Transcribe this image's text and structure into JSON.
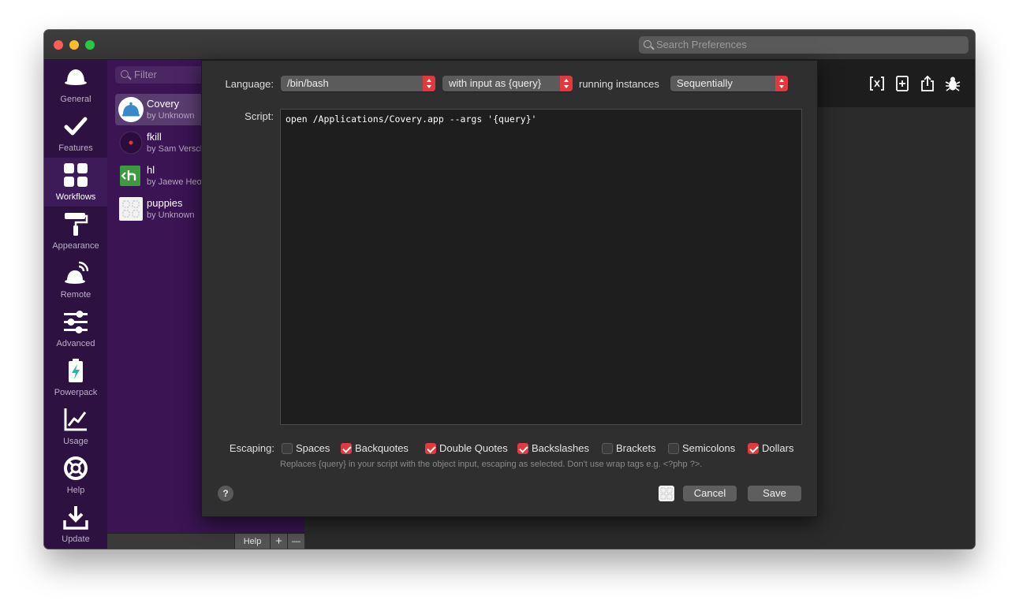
{
  "search": {
    "placeholder": "Search Preferences"
  },
  "sidebar": {
    "items": [
      {
        "label": "General",
        "icon": "hat-icon"
      },
      {
        "label": "Features",
        "icon": "checkmark-icon"
      },
      {
        "label": "Workflows",
        "icon": "grid-icon"
      },
      {
        "label": "Appearance",
        "icon": "paint-roller-icon"
      },
      {
        "label": "Remote",
        "icon": "remote-icon"
      },
      {
        "label": "Advanced",
        "icon": "sliders-icon"
      },
      {
        "label": "Powerpack",
        "icon": "battery-bolt-icon"
      },
      {
        "label": "Usage",
        "icon": "chart-icon"
      },
      {
        "label": "Help",
        "icon": "lifebuoy-icon"
      },
      {
        "label": "Update",
        "icon": "download-icon"
      }
    ],
    "active": "Workflows"
  },
  "workflows": {
    "filter_placeholder": "Filter",
    "items": [
      {
        "name": "Covery",
        "author": "by Unknown"
      },
      {
        "name": "fkill",
        "author": "by Sam Verschueren"
      },
      {
        "name": "hl",
        "author": "by Jaewe Heo"
      },
      {
        "name": "puppies",
        "author": "by Unknown"
      }
    ]
  },
  "bottom_bar": {
    "help": "Help",
    "add": "+",
    "remove": "—"
  },
  "sheet": {
    "language_label": "Language:",
    "language_value": "/bin/bash",
    "input_value": "with input as {query}",
    "running_label": "running instances",
    "running_value": "Sequentially",
    "script_label": "Script:",
    "script_text": "open /Applications/Covery.app --args '{query}'",
    "escaping_label": "Escaping:",
    "escaping": [
      {
        "label": "Spaces",
        "checked": false
      },
      {
        "label": "Backquotes",
        "checked": true
      },
      {
        "label": "Double Quotes",
        "checked": true
      },
      {
        "label": "Backslashes",
        "checked": true
      },
      {
        "label": "Brackets",
        "checked": false
      },
      {
        "label": "Semicolons",
        "checked": false
      },
      {
        "label": "Dollars",
        "checked": true
      }
    ],
    "hint": "Replaces {query} in your script with the object input, escaping as selected. Don't use wrap tags e.g. <?php ?>.",
    "help_glyph": "?",
    "cancel_label": "Cancel",
    "save_label": "Save"
  },
  "colors": {
    "accent": "#e0393e",
    "sidebar": "#2d1140",
    "list": "#3a1453"
  }
}
